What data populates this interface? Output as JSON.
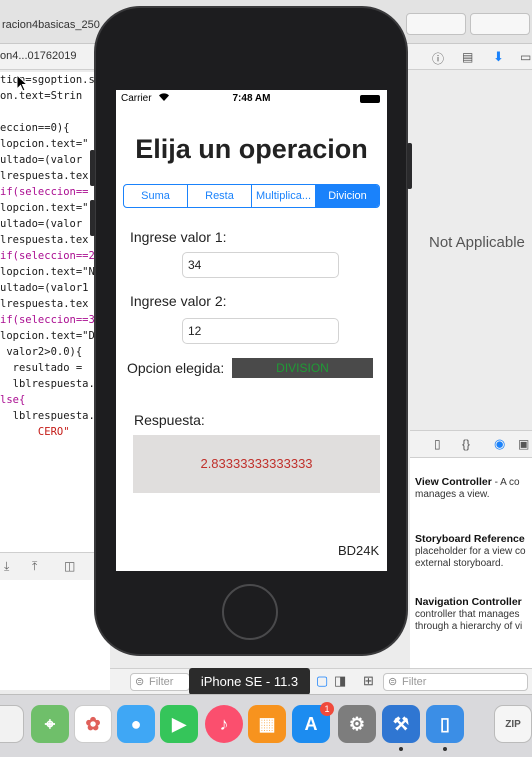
{
  "xcode": {
    "tab_title": "racion4basicas_250",
    "jump_text": "on4...01762019",
    "not_applicable": "Not Applicable",
    "code_lines": [
      "tion=sgoption.s",
      "on.text=Strin",
      "",
      "eccion==0){",
      "lopcion.text=\"",
      "ultado=(valor",
      "lrespuesta.tex",
      "if(seleccion==",
      "lopcion.text=\"",
      "ultado=(valor",
      "lrespuesta.tex",
      "if(seleccion==2",
      "lopcion.text=\"N",
      "ultado=(valor1",
      "lrespuesta.tex",
      "if(seleccion==3",
      "lopcion.text=\"D",
      " valor2>0.0){",
      "  resultado = ",
      "  lblrespuesta.",
      "lse{",
      "  lblrespuesta.",
      "      CERO\""
    ],
    "library": [
      {
        "title": "View Controller",
        "desc": " - A co manages a view."
      },
      {
        "title": "Storyboard Reference",
        "desc": "placeholder for a view co external storyboard."
      },
      {
        "title": "Navigation Controller",
        "desc": "controller that manages through a hierarchy of vi"
      }
    ],
    "filter_placeholder": "Filter",
    "simulator_label": "iPhone SE - 11.3",
    "appstore_badge": "1"
  },
  "status_bar": {
    "carrier": "Carrier",
    "time": "7:48 AM"
  },
  "app": {
    "title": "Elija un operacion",
    "segments": [
      "Suma",
      "Resta",
      "Multiplica...",
      "Divicion"
    ],
    "selected_segment": 3,
    "label_1": "Ingrese valor 1:",
    "value_1": "34",
    "label_2": "Ingrese valor 2:",
    "value_2": "12",
    "opcion_label": "Opcion elegida:",
    "opcion_value": "DIVISION",
    "respuesta_label": "Respuesta:",
    "respuesta_value": "2.83333333333333",
    "signature": "BD24K"
  },
  "colors": {
    "accent": "#1a82fb",
    "opcion_bg": "#4a4a4a",
    "opcion_text": "#1f9b35",
    "respuesta_text": "#c0302b"
  }
}
